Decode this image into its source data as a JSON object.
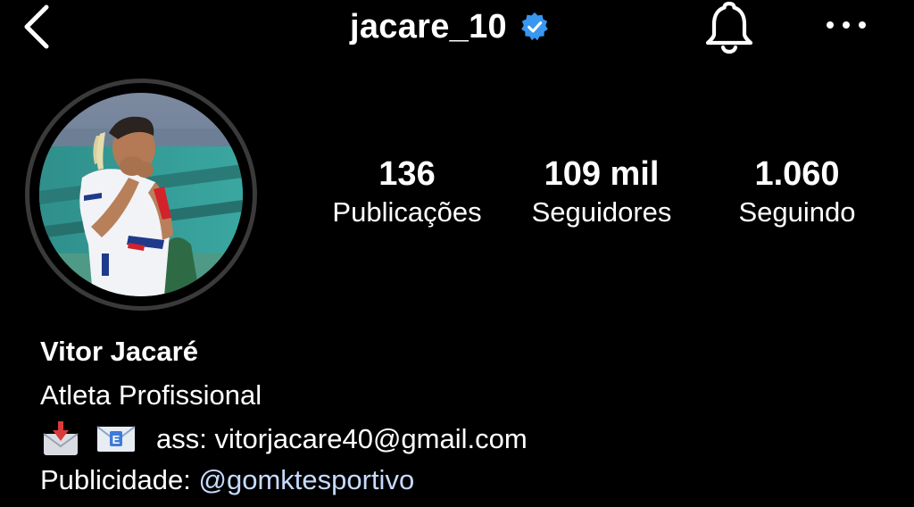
{
  "header": {
    "username": "jacare_10",
    "verified_color": "#3897f0",
    "back_icon": "chevron-left-icon",
    "bell_icon": "bell-icon",
    "more_icon": "ellipsis-icon"
  },
  "profile": {
    "avatar_alt": "profile photo",
    "stats": [
      {
        "value": "136",
        "label": "Publicações"
      },
      {
        "value": "109 mil",
        "label": "Seguidores"
      },
      {
        "value": "1.060",
        "label": "Seguindo"
      }
    ]
  },
  "bio": {
    "name": "Vitor Jacaré",
    "category": "Atleta Profissional",
    "emoji_icons": [
      "inbox-tray-icon",
      "email-icon"
    ],
    "contact_text": "ass: vitorjacare40@gmail.com",
    "ads_prefix": "Publicidade: ",
    "ads_handle": "@gomktesportivo",
    "link_color": "#c7dbff"
  }
}
